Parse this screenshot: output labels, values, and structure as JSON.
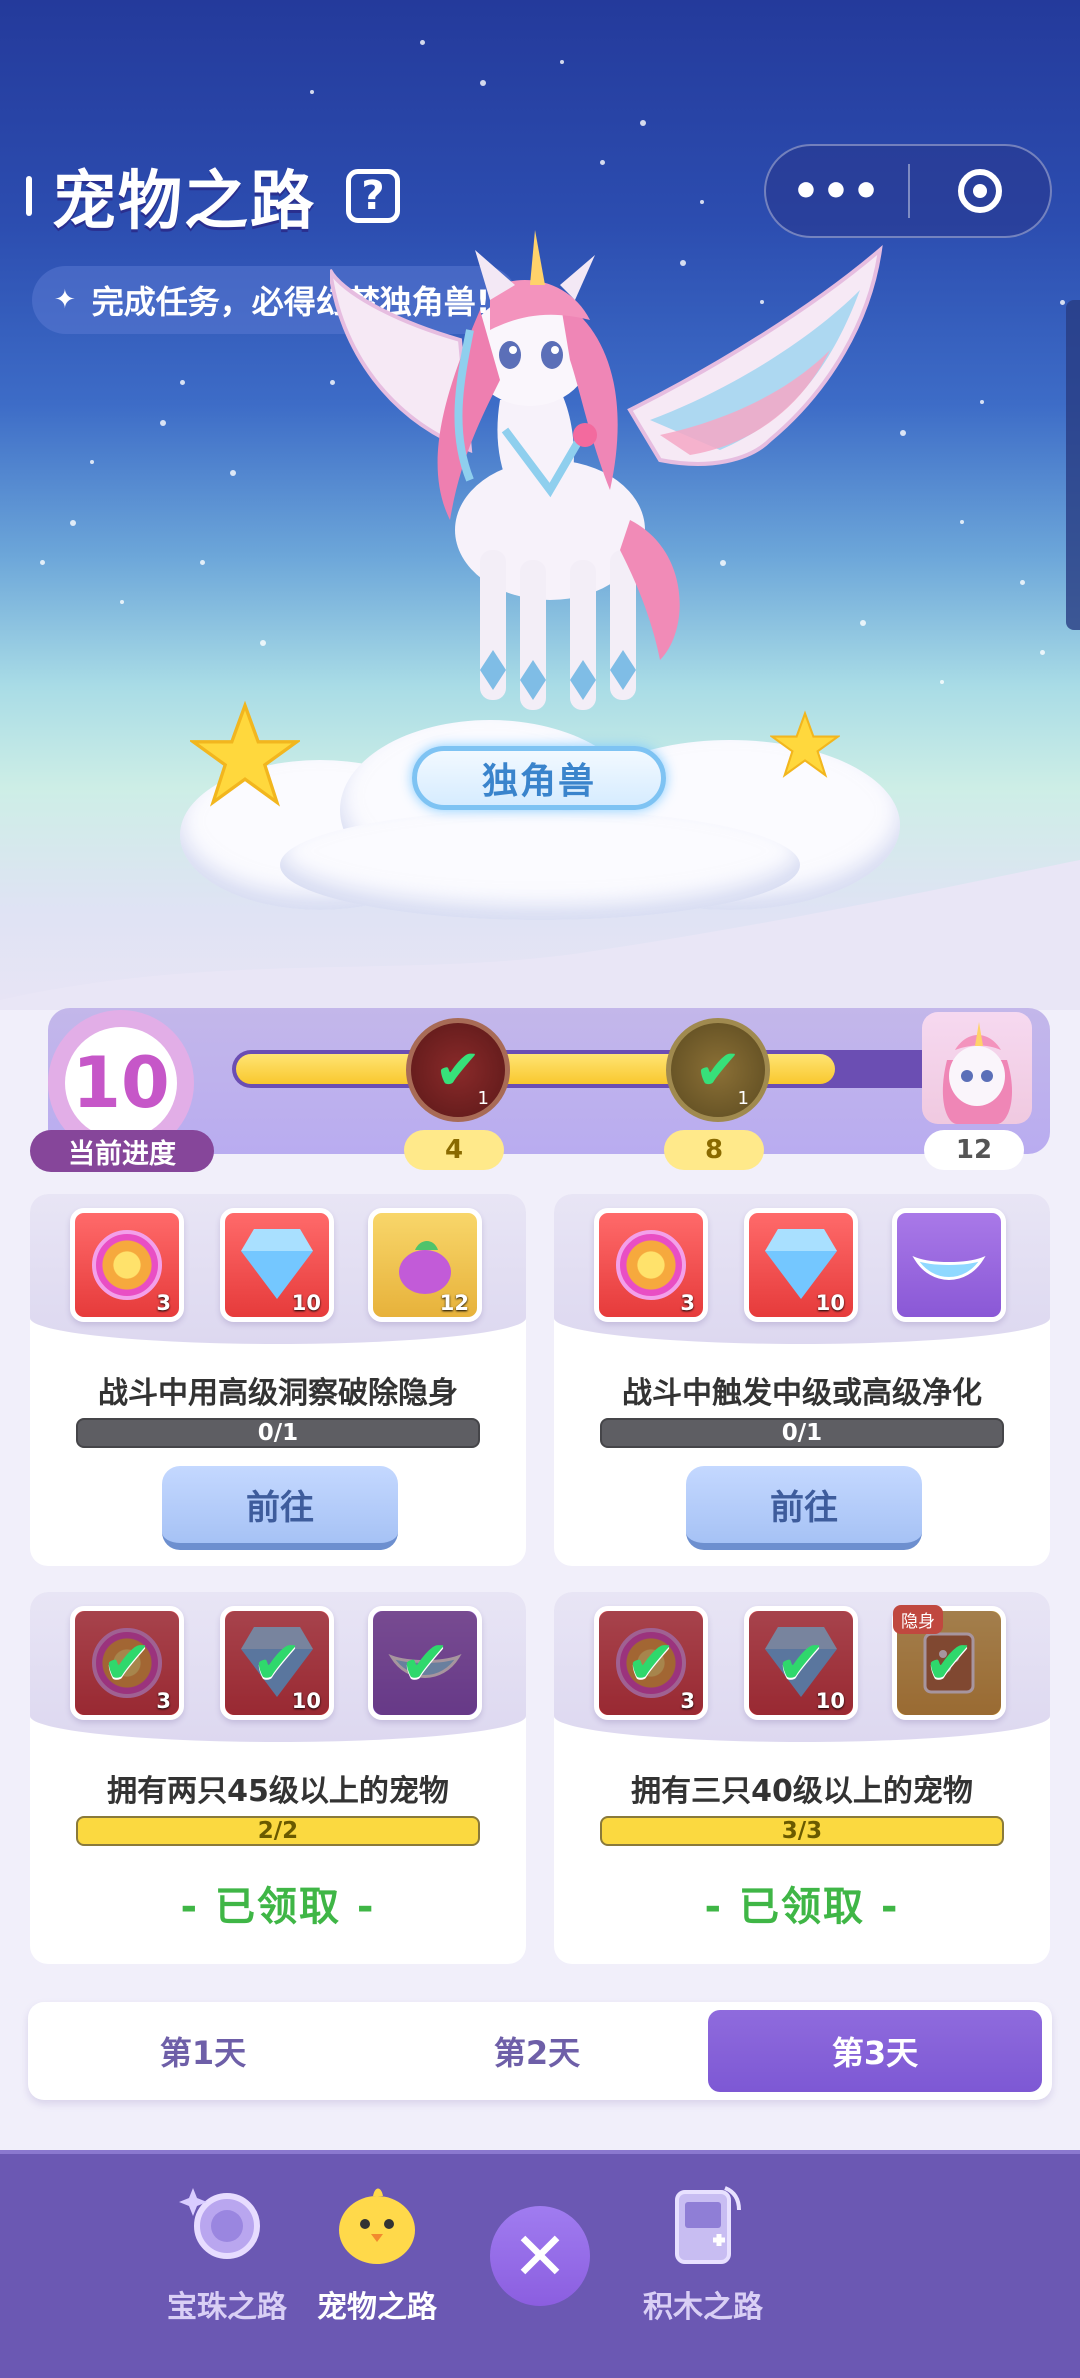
{
  "header": {
    "title": "宠物之路",
    "help_icon": "question-icon",
    "subtitle": "完成任务，必得幻梦独角兽!",
    "more_icon": "•••",
    "target_icon": "target-icon"
  },
  "pet": {
    "name": "独角兽"
  },
  "progress": {
    "current": "10",
    "current_label": "当前进度",
    "fill_fraction": 0.83,
    "milestones": [
      {
        "value": "4",
        "state": "claimed"
      },
      {
        "value": "8",
        "state": "claimed"
      },
      {
        "value": "12",
        "state": "locked"
      }
    ]
  },
  "tasks": [
    {
      "text": "战斗中用高级洞察破除隐身",
      "progress": "0/1",
      "button": "前往",
      "rewards": [
        {
          "icon": "coin",
          "count": "3"
        },
        {
          "icon": "diamond",
          "count": "10"
        },
        {
          "icon": "fruit",
          "count": "12"
        }
      ]
    },
    {
      "text": "战斗中触发中级或高级净化",
      "progress": "0/1",
      "button": "前往",
      "rewards": [
        {
          "icon": "coin",
          "count": "3"
        },
        {
          "icon": "diamond",
          "count": "10"
        },
        {
          "icon": "ice-boat",
          "count": ""
        }
      ]
    },
    {
      "text": "拥有两只45级以上的宠物",
      "progress": "2/2",
      "status": "- 已领取 -",
      "rewards": [
        {
          "icon": "coin",
          "count": "3"
        },
        {
          "icon": "diamond",
          "count": "10"
        },
        {
          "icon": "ice-boat",
          "count": ""
        }
      ]
    },
    {
      "text": "拥有三只40级以上的宠物",
      "progress": "3/3",
      "status": "- 已领取 -",
      "rewards": [
        {
          "icon": "coin",
          "count": "3"
        },
        {
          "icon": "diamond",
          "count": "10"
        },
        {
          "icon": "book",
          "count": "",
          "tag": "隐身"
        }
      ]
    }
  ],
  "day_tabs": [
    "第1天",
    "第2天",
    "第3天"
  ],
  "active_day": 2,
  "bottom_nav": [
    {
      "label": "宝珠之路",
      "icon": "orb-icon"
    },
    {
      "label": "宠物之路",
      "icon": "chick-icon"
    },
    {
      "label": "积木之路",
      "icon": "console-icon"
    }
  ],
  "colors": {
    "accent": "#7d58d4",
    "progress": "#f9c82e",
    "claimed": "#3fb646"
  }
}
